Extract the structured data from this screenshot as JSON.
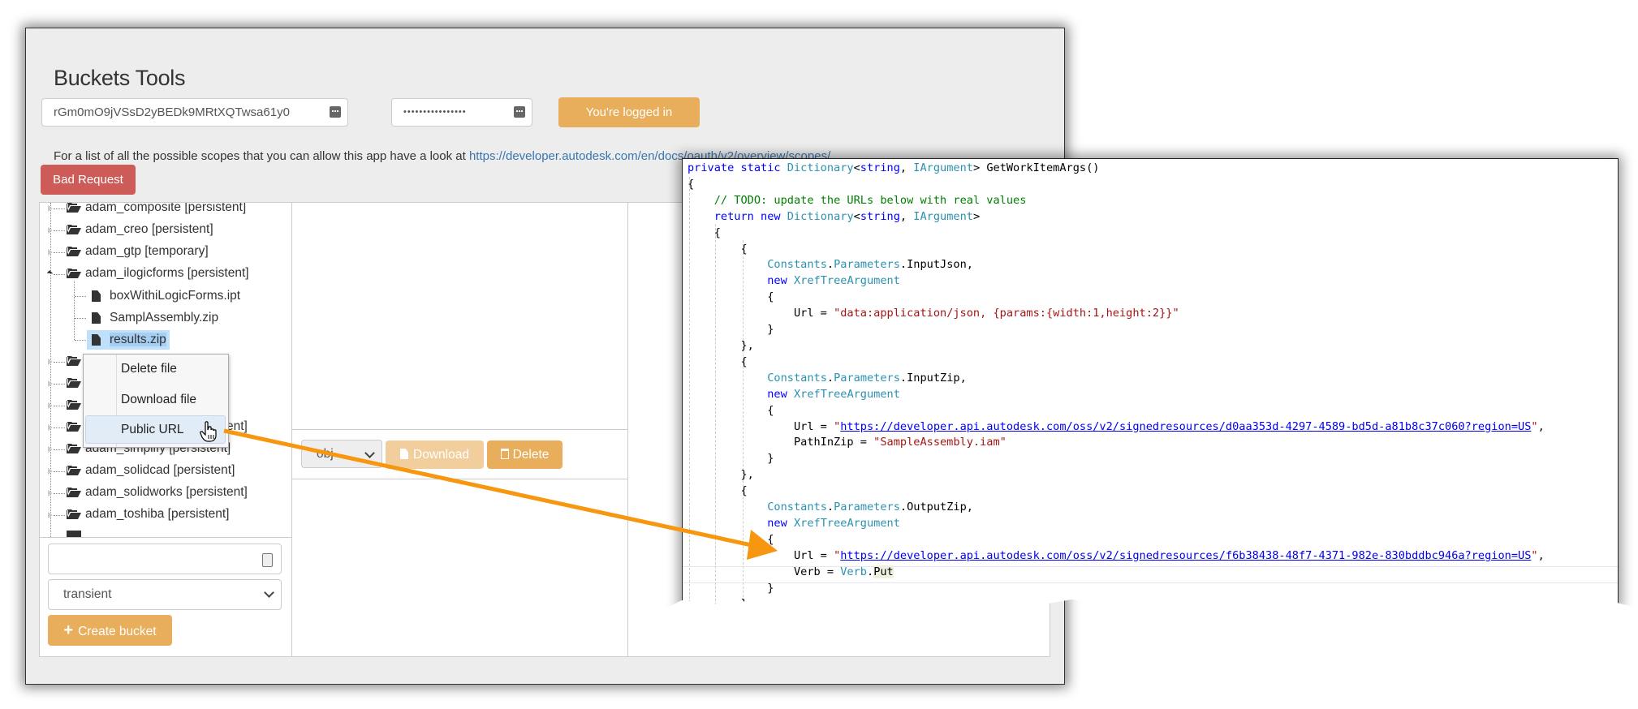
{
  "app": {
    "title": "Buckets Tools",
    "client_id": "rGm0mO9jVSsD2yBEDk9MRtXQTwsa61y0",
    "client_secret_masked": "••••••••••••••••",
    "login_button": "You're logged in",
    "scopes_text": "For a list of all the possible scopes that you can allow this app have a look at ",
    "scopes_link": "https://developer.autodesk.com/en/docs/oauth/v2/overview/scopes/",
    "error_button": "Bad Request"
  },
  "tree": {
    "items": [
      {
        "label": "adam_composite [persistent]",
        "type": "bucket",
        "expanded": false
      },
      {
        "label": "adam_creo [persistent]",
        "type": "bucket",
        "expanded": false
      },
      {
        "label": "adam_gtp [temporary]",
        "type": "bucket",
        "expanded": false
      },
      {
        "label": "adam_ilogicforms [persistent]",
        "type": "bucket",
        "expanded": true,
        "children": [
          {
            "label": "boxWithiLogicForms.ipt",
            "type": "file"
          },
          {
            "label": "SamplAssembly.zip",
            "type": "file"
          },
          {
            "label": "results.zip",
            "type": "file",
            "selected": true
          }
        ]
      },
      {
        "label": "",
        "type": "bucket",
        "expanded": false
      },
      {
        "label": "",
        "type": "bucket",
        "expanded": false
      },
      {
        "label": "",
        "type": "bucket",
        "expanded": false
      },
      {
        "label": "[persistent]",
        "type": "bucket",
        "expanded": false
      },
      {
        "label": "adam_simplify [persistent]",
        "type": "bucket",
        "expanded": false
      },
      {
        "label": "adam_solidcad [persistent]",
        "type": "bucket",
        "expanded": false
      },
      {
        "label": "adam_solidworks [persistent]",
        "type": "bucket",
        "expanded": false
      },
      {
        "label": "adam_toshiba [persistent]",
        "type": "bucket",
        "expanded": false
      }
    ]
  },
  "context_menu": {
    "items": [
      "Delete file",
      "Download file",
      "Public URL"
    ],
    "highlighted": "Public URL"
  },
  "create_bucket": {
    "name_value": "",
    "policy_selected": "transient",
    "button_label": "Create bucket"
  },
  "derivative": {
    "format_selected": "obj",
    "download_label": "Download",
    "delete_label": "Delete"
  },
  "code": {
    "lines": [
      [
        {
          "t": "private static ",
          "c": "kw"
        },
        {
          "t": "Dictionary",
          "c": "ty"
        },
        {
          "t": "<"
        },
        {
          "t": "string",
          "c": "kw"
        },
        {
          "t": ", "
        },
        {
          "t": "IArgument",
          "c": "ty"
        },
        {
          "t": "> GetWorkItemArgs()"
        }
      ],
      [
        {
          "t": "{"
        }
      ],
      [
        {
          "t": "    "
        },
        {
          "t": "// TODO: update the URLs below with real values",
          "c": "cm"
        }
      ],
      [
        {
          "t": "    "
        },
        {
          "t": "return new ",
          "c": "kw"
        },
        {
          "t": "Dictionary",
          "c": "ty"
        },
        {
          "t": "<"
        },
        {
          "t": "string",
          "c": "kw"
        },
        {
          "t": ", "
        },
        {
          "t": "IArgument",
          "c": "ty"
        },
        {
          "t": ">"
        }
      ],
      [
        {
          "t": "    {"
        }
      ],
      [
        {
          "t": "        {"
        }
      ],
      [
        {
          "t": "            "
        },
        {
          "t": "Constants",
          "c": "ty"
        },
        {
          "t": "."
        },
        {
          "t": "Parameters",
          "c": "ty"
        },
        {
          "t": ".InputJson,"
        }
      ],
      [
        {
          "t": "            "
        },
        {
          "t": "new ",
          "c": "kw"
        },
        {
          "t": "XrefTreeArgument",
          "c": "ty"
        }
      ],
      [
        {
          "t": "            {"
        }
      ],
      [
        {
          "t": "                Url = "
        },
        {
          "t": "\"data:application/json, {params:{width:1,height:2}}\"",
          "c": "st"
        }
      ],
      [
        {
          "t": "            }"
        }
      ],
      [
        {
          "t": "        },"
        }
      ],
      [
        {
          "t": "        {"
        }
      ],
      [
        {
          "t": "            "
        },
        {
          "t": "Constants",
          "c": "ty"
        },
        {
          "t": "."
        },
        {
          "t": "Parameters",
          "c": "ty"
        },
        {
          "t": ".InputZip,"
        }
      ],
      [
        {
          "t": "            "
        },
        {
          "t": "new ",
          "c": "kw"
        },
        {
          "t": "XrefTreeArgument",
          "c": "ty"
        }
      ],
      [
        {
          "t": "            {"
        }
      ],
      [
        {
          "t": "                Url = "
        },
        {
          "t": "\"",
          "c": "st"
        },
        {
          "t": "https://developer.api.autodesk.com/oss/v2/signedresources/d0aa353d-4297-4589-bd5d-a81b8c37c060?region=US",
          "c": "lk"
        },
        {
          "t": "\"",
          "c": "st"
        },
        {
          "t": ","
        }
      ],
      [
        {
          "t": "                PathInZip = "
        },
        {
          "t": "\"SampleAssembly.iam\"",
          "c": "st"
        }
      ],
      [
        {
          "t": "            }"
        }
      ],
      [
        {
          "t": "        },"
        }
      ],
      [
        {
          "t": "        {"
        }
      ],
      [
        {
          "t": "            "
        },
        {
          "t": "Constants",
          "c": "ty"
        },
        {
          "t": "."
        },
        {
          "t": "Parameters",
          "c": "ty"
        },
        {
          "t": ".OutputZip,"
        }
      ],
      [
        {
          "t": "            "
        },
        {
          "t": "new ",
          "c": "kw"
        },
        {
          "t": "XrefTreeArgument",
          "c": "ty"
        }
      ],
      [
        {
          "t": "            {"
        }
      ],
      [
        {
          "t": "                Url = "
        },
        {
          "t": "\"",
          "c": "st"
        },
        {
          "t": "https://developer.api.autodesk.com/oss/v2/signedresources/f6b38438-48f7-4371-982e-830bddbc946a?region=US",
          "c": "lk"
        },
        {
          "t": "\"",
          "c": "st"
        },
        {
          "t": ","
        }
      ],
      [
        {
          "t": "                Verb = "
        },
        {
          "t": "Verb",
          "c": "ty"
        },
        {
          "t": "."
        },
        {
          "t": "Put",
          "c": "hlword"
        }
      ],
      [
        {
          "t": "            }"
        }
      ],
      [
        {
          "t": "        },"
        }
      ]
    ]
  },
  "colors": {
    "accent_orange": "#e8ae5b",
    "error_red": "#cd5b58",
    "annotation_arrow": "#f7960f",
    "link_blue": "#3a76b0"
  }
}
